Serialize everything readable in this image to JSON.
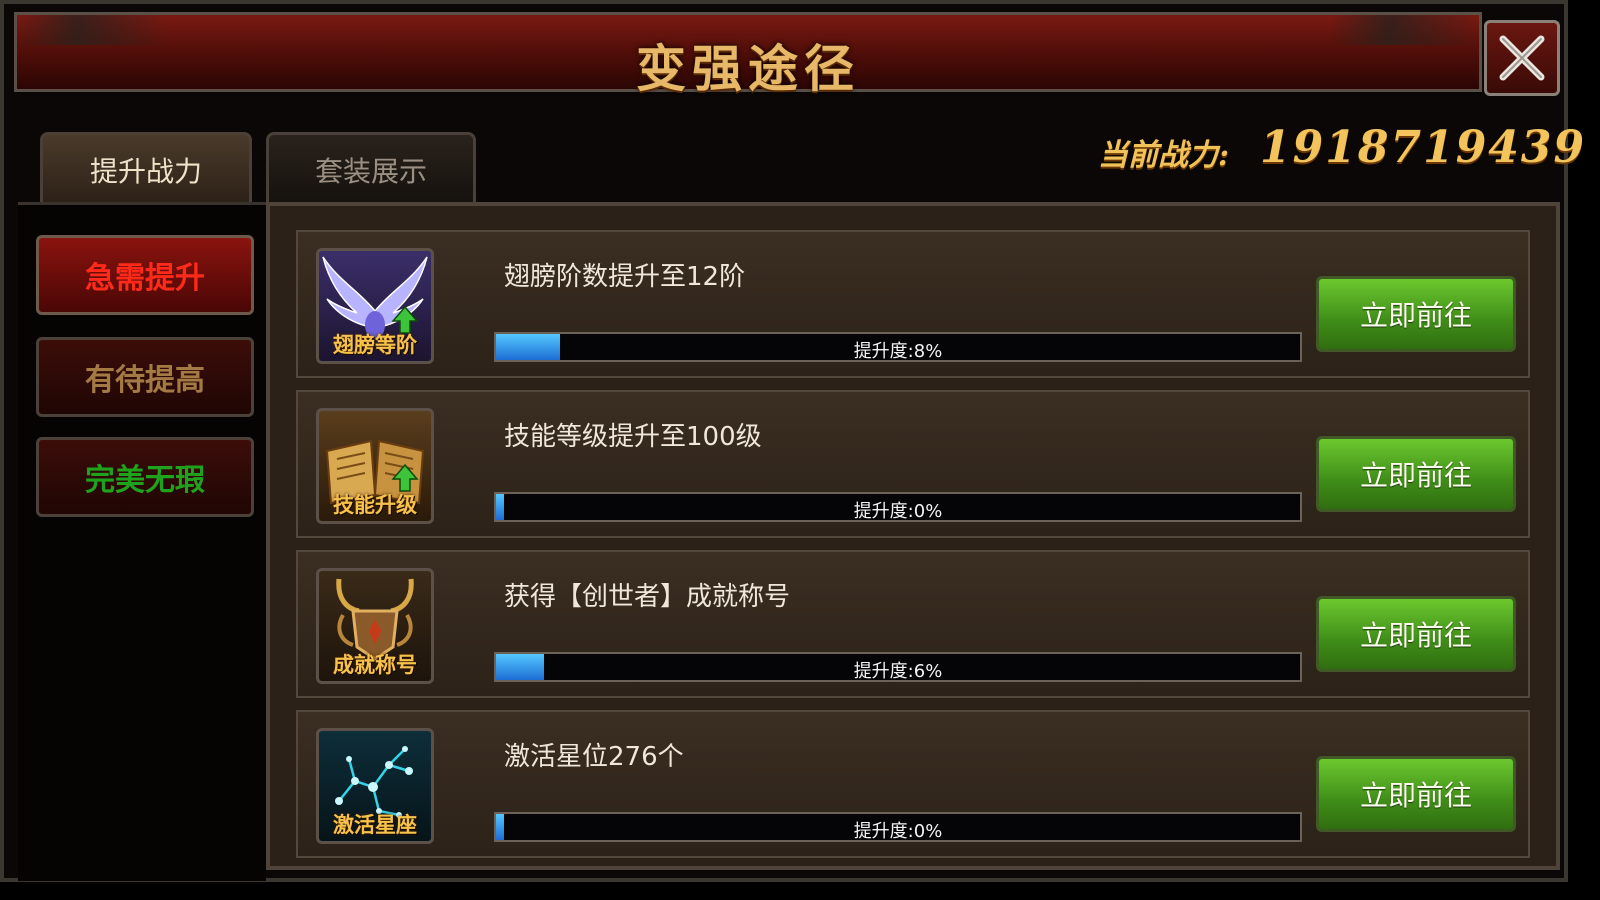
{
  "header": {
    "title": "变强途径",
    "close_icon": "close-icon"
  },
  "tabs": [
    {
      "label": "提升战力",
      "active": true
    },
    {
      "label": "套装展示",
      "active": false
    }
  ],
  "power": {
    "label": "当前战力:",
    "value": "1918719439"
  },
  "sidebar": {
    "items": [
      {
        "label": "急需提升",
        "color": "#ff2a1a",
        "selected": true
      },
      {
        "label": "有待提高",
        "color": "#a37a43",
        "selected": false
      },
      {
        "label": "完美无瑕",
        "color": "#1fa31c",
        "selected": false
      }
    ]
  },
  "tasks": [
    {
      "icon": "wings-icon",
      "icon_label": "翅膀等阶",
      "text": "翅膀阶数提升至12阶",
      "progress_label": "提升度:8%",
      "progress": 8,
      "button": "立即前往"
    },
    {
      "icon": "skill-book-icon",
      "icon_label": "技能升级",
      "text": "技能等级提升至100级",
      "progress_label": "提升度:0%",
      "progress": 0,
      "button": "立即前往"
    },
    {
      "icon": "achievement-icon",
      "icon_label": "成就称号",
      "text": "获得【创世者】成就称号",
      "progress_label": "提升度:6%",
      "progress": 6,
      "button": "立即前往"
    },
    {
      "icon": "constellation-icon",
      "icon_label": "激活星座",
      "text": "激活星位276个",
      "progress_label": "提升度:0%",
      "progress": 0,
      "button": "立即前往"
    }
  ],
  "colors": {
    "accent_gold": "#f3c45c",
    "button_green": "#3f8d18",
    "bar_blue": "#1d6ed4"
  }
}
